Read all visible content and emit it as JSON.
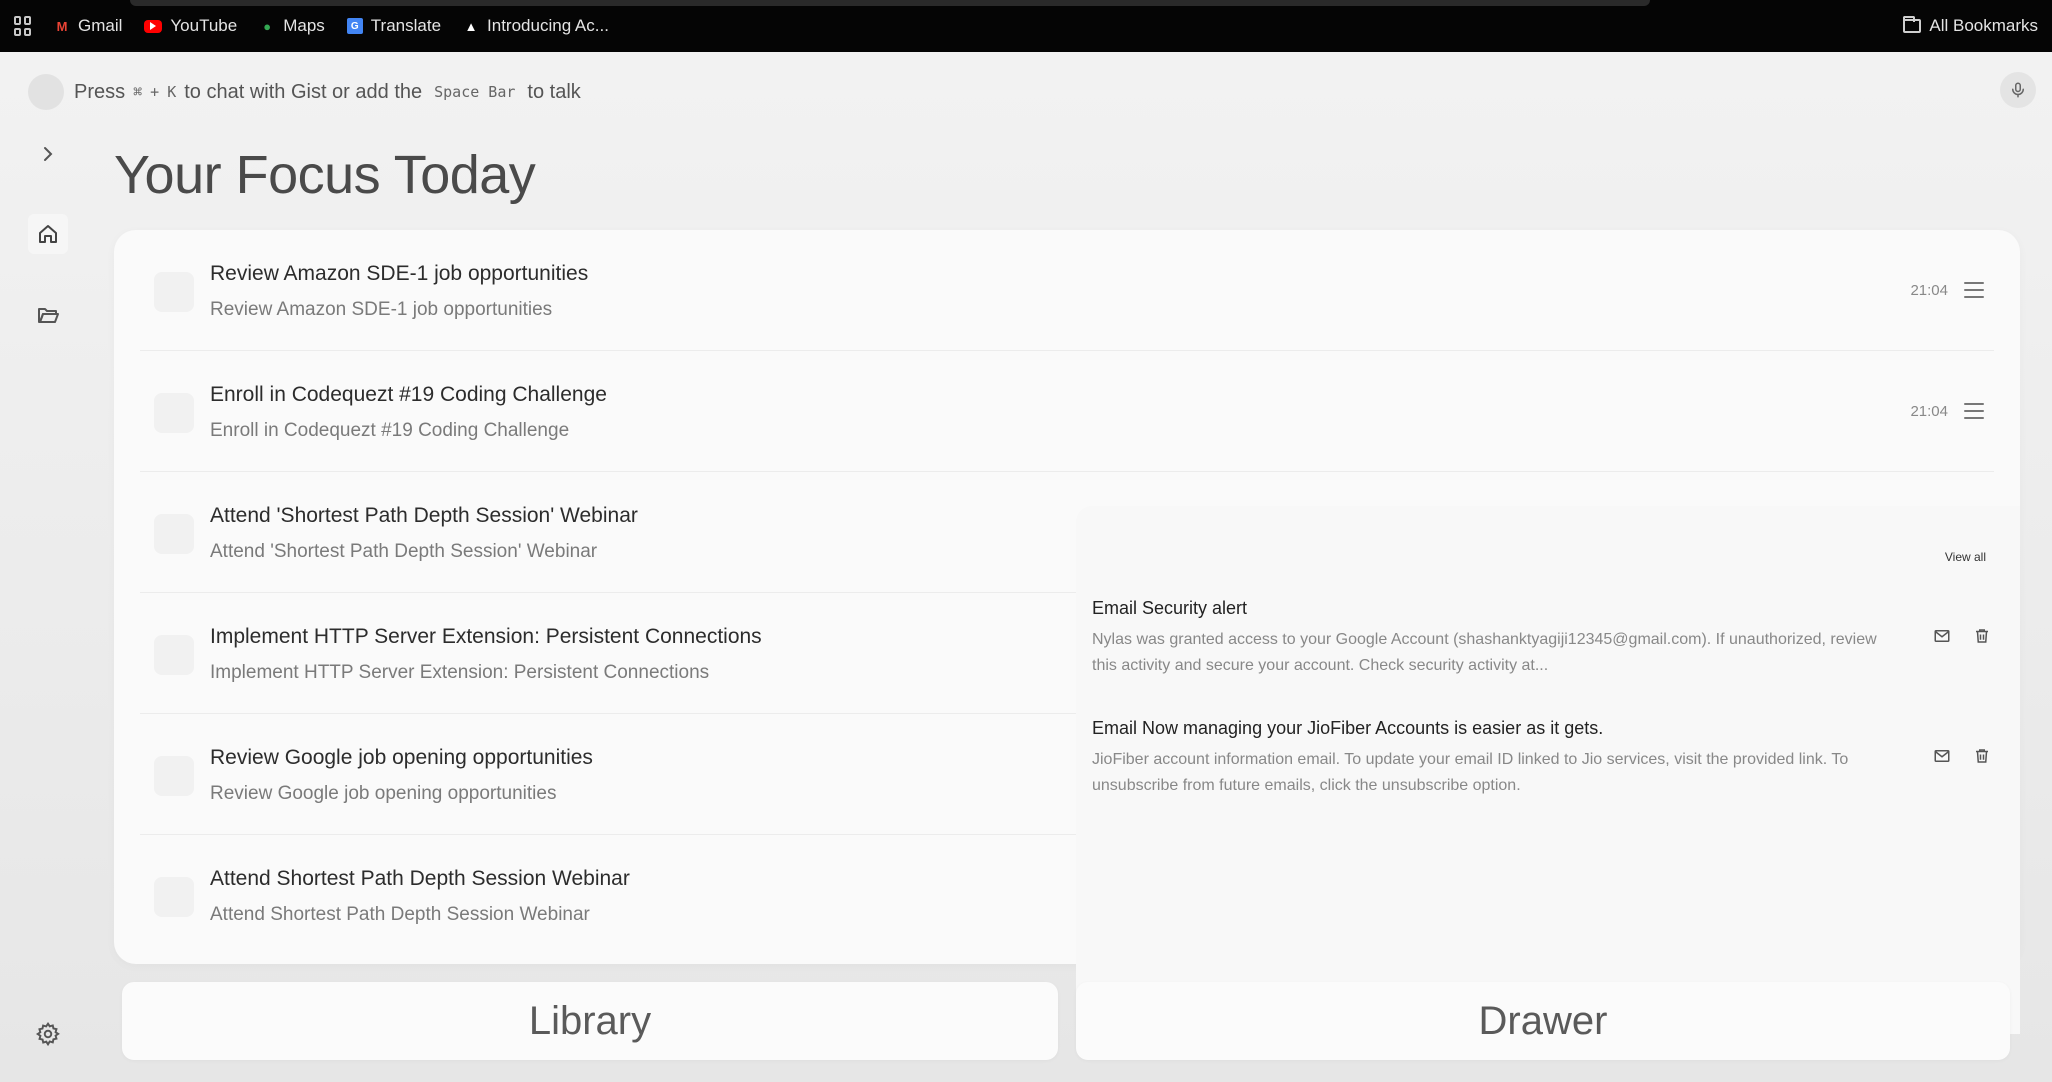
{
  "bookmarks": {
    "items": [
      {
        "label": "Gmail",
        "icon": "gmail-icon"
      },
      {
        "label": "YouTube",
        "icon": "youtube-icon"
      },
      {
        "label": "Maps",
        "icon": "maps-icon"
      },
      {
        "label": "Translate",
        "icon": "translate-icon"
      },
      {
        "label": "Introducing Ac...",
        "icon": "app-icon"
      }
    ],
    "all_bookmarks": "All Bookmarks"
  },
  "gist": {
    "press": "Press",
    "key_cmd": "⌘",
    "plus": "+",
    "key_k": "K",
    "mid_text": "to chat with Gist or add the",
    "key_space": "Space Bar",
    "end_text": "to talk"
  },
  "page": {
    "title": "Your Focus Today"
  },
  "tasks": [
    {
      "title": "Review Amazon SDE-1 job opportunities",
      "subtitle": "Review Amazon SDE-1 job opportunities",
      "time": "21:04"
    },
    {
      "title": "Enroll in Codequezt #19 Coding Challenge",
      "subtitle": "Enroll in Codequezt #19 Coding Challenge",
      "time": "21:04"
    },
    {
      "title": "Attend 'Shortest Path Depth Session' Webinar",
      "subtitle": "Attend 'Shortest Path Depth Session' Webinar"
    },
    {
      "title": "Implement HTTP Server Extension: Persistent Connections",
      "subtitle": "Implement HTTP Server Extension: Persistent Connections"
    },
    {
      "title": "Review Google job opening opportunities",
      "subtitle": "Review Google job opening opportunities"
    },
    {
      "title": "Attend Shortest Path Depth Session Webinar",
      "subtitle": "Attend Shortest Path Depth Session Webinar"
    }
  ],
  "drawer": {
    "view_all": "View all",
    "emails": [
      {
        "title": "Email Security alert",
        "body": "Nylas was granted access to your Google Account (shashanktyagiji12345@gmail.com). If unauthorized, review this activity and secure your account. Check security activity at..."
      },
      {
        "title": "Email Now managing your JioFiber Accounts is easier as it gets.",
        "body": "JioFiber account information email. To update your email ID linked to Jio services, visit the provided link. To unsubscribe from future emails, click the unsubscribe option."
      }
    ]
  },
  "buttons": {
    "library": "Library",
    "drawer": "Drawer"
  }
}
